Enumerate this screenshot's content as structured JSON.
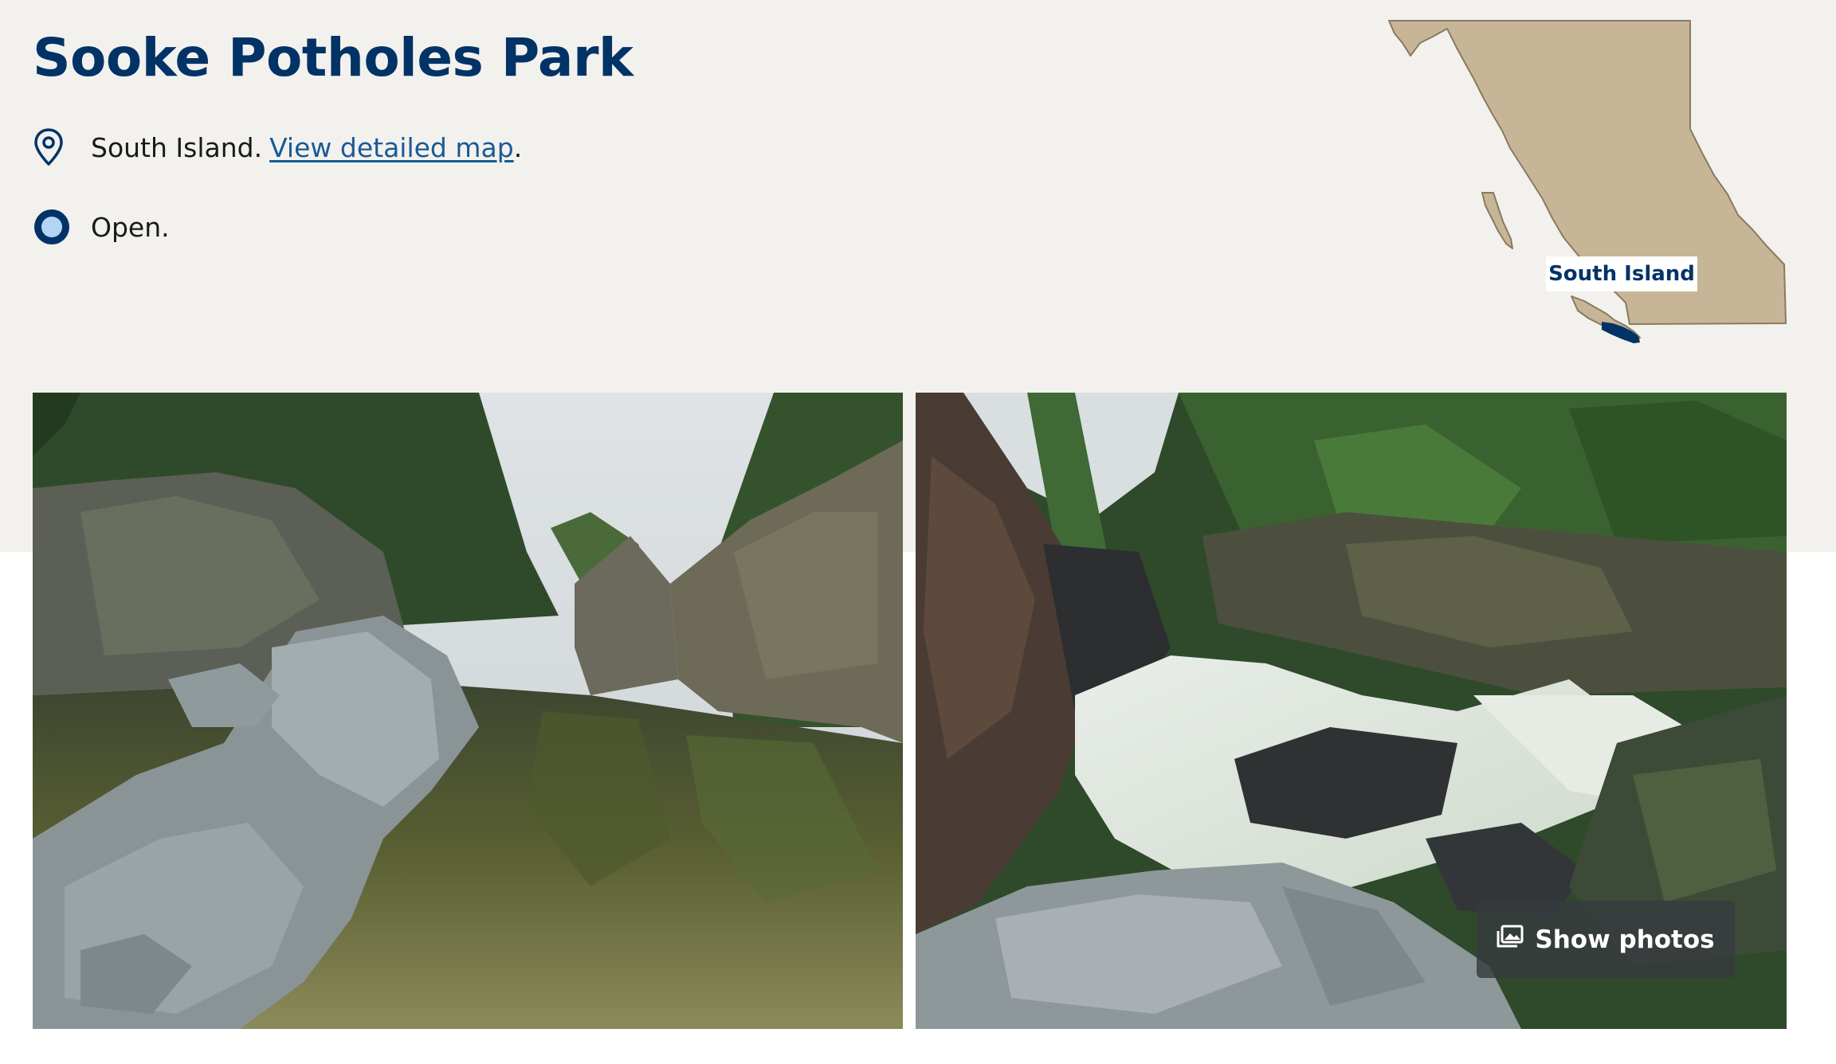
{
  "park": {
    "title": "Sooke Potholes Park"
  },
  "location": {
    "region": "South Island.",
    "map_link_label": "View detailed map",
    "trailing_period": ".",
    "icon": "map-pin-icon"
  },
  "status": {
    "label": "Open.",
    "icon": "status-dot-icon"
  },
  "overview_map": {
    "region_label": "South Island",
    "land_color": "#c7b597",
    "outline_color": "#8a7a5e",
    "highlight_color": "#013366"
  },
  "gallery": {
    "show_photos_label": "Show photos",
    "icon": "photo-gallery-icon"
  },
  "colors": {
    "brand_navy": "#013366",
    "link_blue": "#1a5a96",
    "band_background": "#f3f1ee",
    "status_light": "#b3d4f5"
  }
}
